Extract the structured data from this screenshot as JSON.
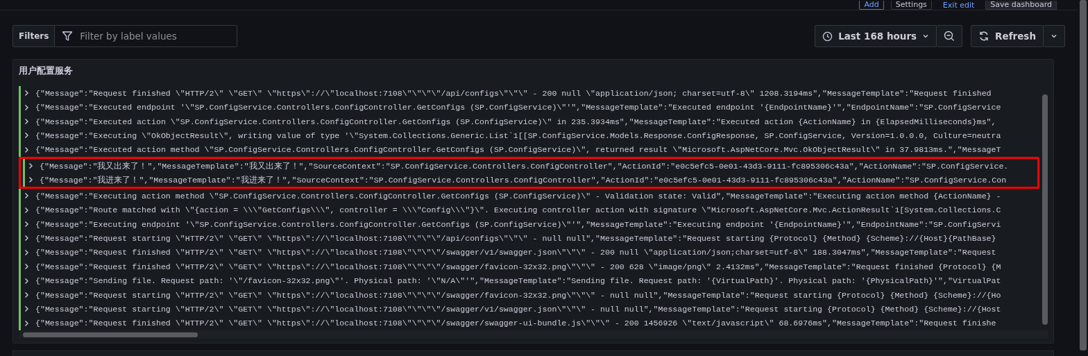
{
  "top_bar": {
    "buttons": [
      "Add",
      "Settings",
      "Exit edit",
      "Save dashboard"
    ]
  },
  "filters": {
    "label": "Filters",
    "placeholder": "Filter by label values"
  },
  "time_picker": {
    "label": "Last 168 hours"
  },
  "refresh": {
    "label": "Refresh"
  },
  "panel": {
    "title": "用户配置服务",
    "rows": [
      {
        "text": "{\"Message\":\"Request finished \\\"HTTP/2\\\" \\\"GET\\\" \\\"https\\\"://\\\"localhost:7108\\\"\\\"\\\"\\\"/api/configs\\\"\\\"\\\" - 200 null \\\"application/json; charset=utf-8\\\" 1208.3194ms\",\"MessageTemplate\":\"Request finished",
        "highlighted": false
      },
      {
        "text": "{\"Message\":\"Executed endpoint '\\\"SP.ConfigService.Controllers.ConfigController.GetConfigs (SP.ConfigService)\\\"'\",\"MessageTemplate\":\"Executed endpoint '{EndpointName}'\",\"EndpointName\":\"SP.ConfigService",
        "highlighted": false
      },
      {
        "text": "{\"Message\":\"Executed action \\\"SP.ConfigService.Controllers.ConfigController.GetConfigs (SP.ConfigService)\\\" in 235.3934ms\",\"MessageTemplate\":\"Executed action {ActionName} in {ElapsedMilliseconds}ms\",",
        "highlighted": false
      },
      {
        "text": "{\"Message\":\"Executing \\\"OkObjectResult\\\", writing value of type '\\\"System.Collections.Generic.List`1[[SP.ConfigService.Models.Response.ConfigResponse, SP.ConfigService, Version=1.0.0.0, Culture=neutra",
        "highlighted": false
      },
      {
        "text": "{\"Message\":\"Executed action method \\\"SP.ConfigService.Controllers.ConfigController.GetConfigs (SP.ConfigService)\\\", returned result \\\"Microsoft.AspNetCore.Mvc.OkObjectResult\\\" in 37.9813ms.\",\"MessageT",
        "highlighted": false
      },
      {
        "text": "{\"Message\":\"我又出来了！\",\"MessageTemplate\":\"我又出来了！\",\"SourceContext\":\"SP.ConfigService.Controllers.ConfigController\",\"ActionId\":\"e0c5efc5-0e01-43d3-9111-fc895306c43a\",\"ActionName\":\"SP.ConfigService.",
        "highlighted": true
      },
      {
        "text": "{\"Message\":\"我进来了！\",\"MessageTemplate\":\"我进来了！\",\"SourceContext\":\"SP.ConfigService.Controllers.ConfigController\",\"ActionId\":\"e0c5efc5-0e01-43d3-9111-fc895306c43a\",\"ActionName\":\"SP.ConfigService.Con",
        "highlighted": true
      },
      {
        "text": "{\"Message\":\"Executing action method \\\"SP.ConfigService.Controllers.ConfigController.GetConfigs (SP.ConfigService)\\\" - Validation state: Valid\",\"MessageTemplate\":\"Executing action method {ActionName} -",
        "highlighted": false
      },
      {
        "text": "{\"Message\":\"Route matched with \\\"{action = \\\\\\\"GetConfigs\\\\\\\", controller = \\\\\\\"Config\\\\\\\"}\\\". Executing controller action with signature \\\"Microsoft.AspNetCore.Mvc.ActionResult`1[System.Collections.C",
        "highlighted": false
      },
      {
        "text": "{\"Message\":\"Executing endpoint '\\\"SP.ConfigService.Controllers.ConfigController.GetConfigs (SP.ConfigService)\\\"'\",\"MessageTemplate\":\"Executing endpoint '{EndpointName}'\",\"EndpointName\":\"SP.ConfigServi",
        "highlighted": false
      },
      {
        "text": "{\"Message\":\"Request starting \\\"HTTP/2\\\" \\\"GET\\\" \\\"https\\\"://\\\"localhost:7108\\\"\\\"\\\"\\\"/api/configs\\\"\\\"\\\" - null null\",\"MessageTemplate\":\"Request starting {Protocol} {Method} {Scheme}://{Host}{PathBase}",
        "highlighted": false
      },
      {
        "text": "{\"Message\":\"Request finished \\\"HTTP/2\\\" \\\"GET\\\" \\\"https\\\"://\\\"localhost:7108\\\"\\\"\\\"\\\"/swagger/v1/swagger.json\\\"\\\"\\\" - 200 null \\\"application/json;charset=utf-8\\\" 188.3047ms\",\"MessageTemplate\":\"Request",
        "highlighted": false
      },
      {
        "text": "{\"Message\":\"Request finished \\\"HTTP/2\\\" \\\"GET\\\" \\\"https\\\"://\\\"localhost:7108\\\"\\\"\\\"\\\"/swagger/favicon-32x32.png\\\"\\\"\\\" - 200 628 \\\"image/png\\\" 2.4132ms\",\"MessageTemplate\":\"Request finished {Protocol} {M",
        "highlighted": false
      },
      {
        "text": "{\"Message\":\"Sending file. Request path: '\\\"/favicon-32x32.png\\\"'. Physical path: '\\\"N/A\\\"'\",\"MessageTemplate\":\"Sending file. Request path: '{VirtualPath}'. Physical path: '{PhysicalPath}'\",\"VirtualPat",
        "highlighted": false
      },
      {
        "text": "{\"Message\":\"Request starting \\\"HTTP/2\\\" \\\"GET\\\" \\\"https\\\"://\\\"localhost:7108\\\"\\\"\\\"\\\"/swagger/favicon-32x32.png\\\"\\\"\\\" - null null\",\"MessageTemplate\":\"Request starting {Protocol} {Method} {Scheme}://{Ho",
        "highlighted": false
      },
      {
        "text": "{\"Message\":\"Request starting \\\"HTTP/2\\\" \\\"GET\\\" \\\"https\\\"://\\\"localhost:7108\\\"\\\"\\\"\\\"/swagger/v1/swagger.json\\\"\\\"\\\" - null null\",\"MessageTemplate\":\"Request starting {Protocol} {Method} {Scheme}://{Host",
        "highlighted": false
      },
      {
        "text": "{\"Message\":\"Request finished \\\"HTTP/2\\\" \\\"GET\\\" \\\"https\\\"://\\\"localhost:7108\\\"\\\"\\\"\\\"/swagger/swagger-ui-bundle.js\\\"\\\"\\\" - 200 1456926 \\\"text/javascript\\\" 68.6976ms\",\"MessageTemplate\":\"Request finishe",
        "highlighted": false
      }
    ]
  }
}
